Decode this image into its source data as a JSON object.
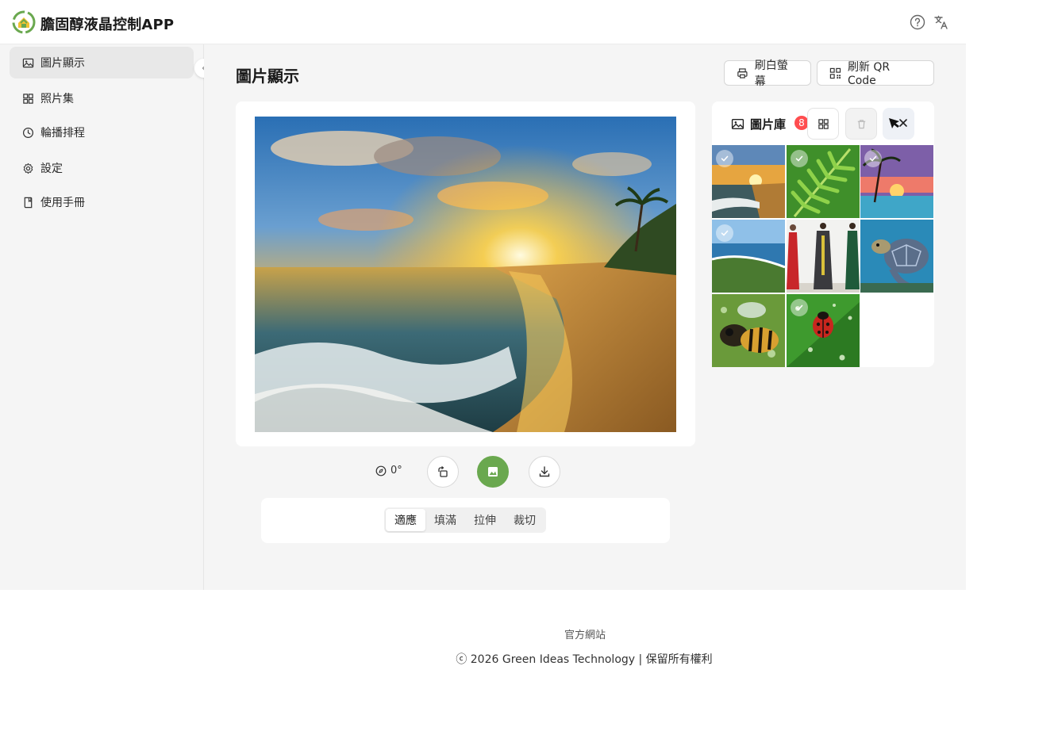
{
  "header": {
    "app_title": "膽固醇液晶控制APP",
    "icons": [
      "help-icon",
      "translate-icon"
    ]
  },
  "sidebar": {
    "items": [
      {
        "label": "圖片顯示",
        "icon": "image-icon",
        "active": true
      },
      {
        "label": "照片集",
        "icon": "grid-icon",
        "active": false
      },
      {
        "label": "輪播排程",
        "icon": "clock-icon",
        "active": false
      },
      {
        "label": "設定",
        "icon": "gear-icon",
        "active": false
      },
      {
        "label": "使用手冊",
        "icon": "book-icon",
        "active": false
      }
    ]
  },
  "main": {
    "page_title": "圖片顯示",
    "refresh_screen_label": "刷白螢幕",
    "refresh_qr_label": "刷新 QR Code",
    "rotation_value": "0°",
    "fit_modes": [
      "適應",
      "填滿",
      "拉伸",
      "裁切"
    ],
    "active_fit_mode": "適應"
  },
  "gallery": {
    "title": "圖片庫",
    "count": "8",
    "thumbnails": [
      {
        "subject": "beach-sunset",
        "checked": true
      },
      {
        "subject": "fern-leaf",
        "checked": true
      },
      {
        "subject": "palm-sunset",
        "checked": true
      },
      {
        "subject": "coastline",
        "checked": true
      },
      {
        "subject": "fashion-models",
        "checked": false
      },
      {
        "subject": "sea-turtle",
        "checked": false
      },
      {
        "subject": "bee-macro",
        "checked": false
      },
      {
        "subject": "ladybug-leaf",
        "checked": true
      }
    ]
  },
  "footer": {
    "official_site": "官方網站",
    "copyright": "ⓒ 2026 Green Ideas Technology | 保留所有權利"
  },
  "colors": {
    "accent_green": "#6aa84f",
    "badge_red": "#ff4d4f",
    "sidebar_bg": "#f5f5f5"
  }
}
